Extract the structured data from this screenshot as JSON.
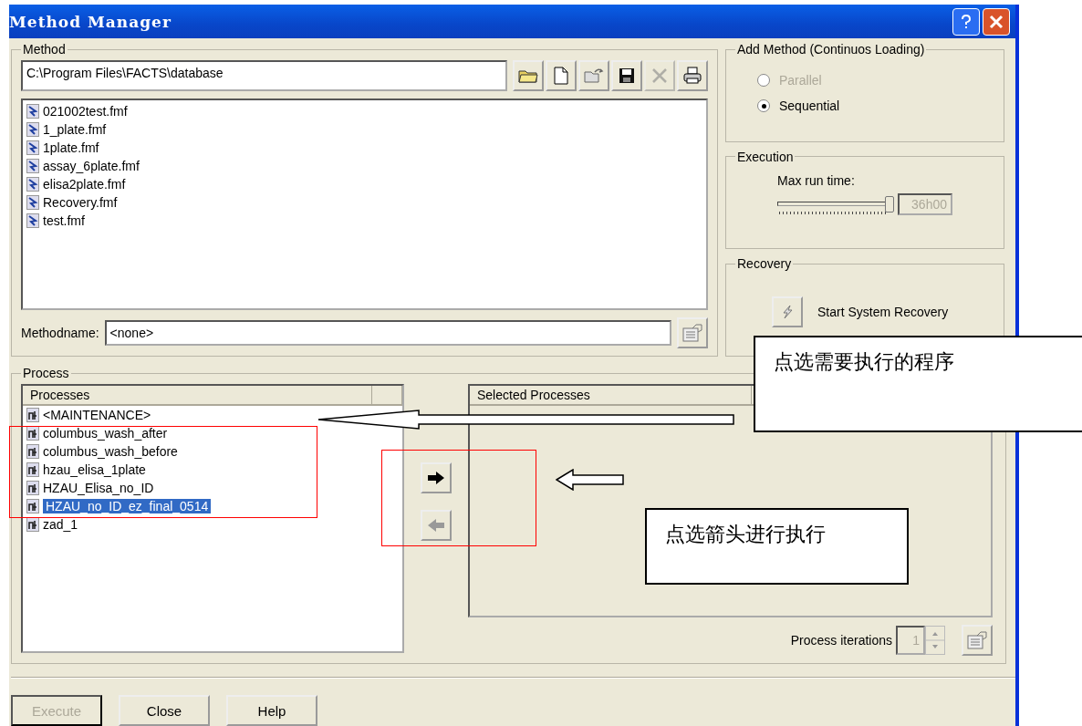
{
  "window": {
    "title": "Method Manager"
  },
  "method": {
    "label": "Method",
    "path": "C:\\Program Files\\FACTS\\database",
    "toolbar": [
      {
        "kind": "folder",
        "disabled": false
      },
      {
        "kind": "new",
        "disabled": false
      },
      {
        "kind": "open",
        "disabled": false
      },
      {
        "kind": "save",
        "disabled": false
      },
      {
        "kind": "delete",
        "disabled": true
      },
      {
        "kind": "print",
        "disabled": false
      }
    ],
    "files": [
      "021002test.fmf",
      "1_plate.fmf",
      "1plate.fmf",
      "assay_6plate.fmf",
      "elisa2plate.fmf",
      "Recovery.fmf",
      "test.fmf"
    ],
    "methodname_label": "Methodname:",
    "methodname": "<none>"
  },
  "add_method": {
    "label": "Add Method (Continuos Loading)",
    "options": [
      {
        "label": "Parallel",
        "selected": false,
        "disabled": true
      },
      {
        "label": "Sequential",
        "selected": true,
        "disabled": false
      }
    ]
  },
  "execution": {
    "label": "Execution",
    "max_run_time_label": "Max run time:",
    "level": 1.0,
    "reading": "36h00"
  },
  "recovery": {
    "label": "Recovery",
    "button": "Start System Recovery"
  },
  "process": {
    "label": "Process",
    "processes_header": "Processes",
    "processes": [
      {
        "name": "<MAINTENANCE>",
        "selected": false
      },
      {
        "name": "columbus_wash_after",
        "selected": false
      },
      {
        "name": "columbus_wash_before",
        "selected": false
      },
      {
        "name": "hzau_elisa_1plate",
        "selected": false
      },
      {
        "name": "HZAU_Elisa_no_ID",
        "selected": false
      },
      {
        "name": "HZAU_no_ID_ez_final_0514",
        "selected": true
      },
      {
        "name": "zad_1",
        "selected": false
      }
    ],
    "selected_header": "Selected Processes",
    "add_disabled": false,
    "remove_disabled": true,
    "iterations_label": "Process iterations",
    "iterations": "1"
  },
  "buttons": [
    {
      "label": "Execute",
      "disabled": true
    },
    {
      "label": "Close",
      "disabled": false
    },
    {
      "label": "Help",
      "disabled": false
    }
  ],
  "callouts": [
    "点选需要执行的程序",
    "点选箭头进行执行"
  ]
}
